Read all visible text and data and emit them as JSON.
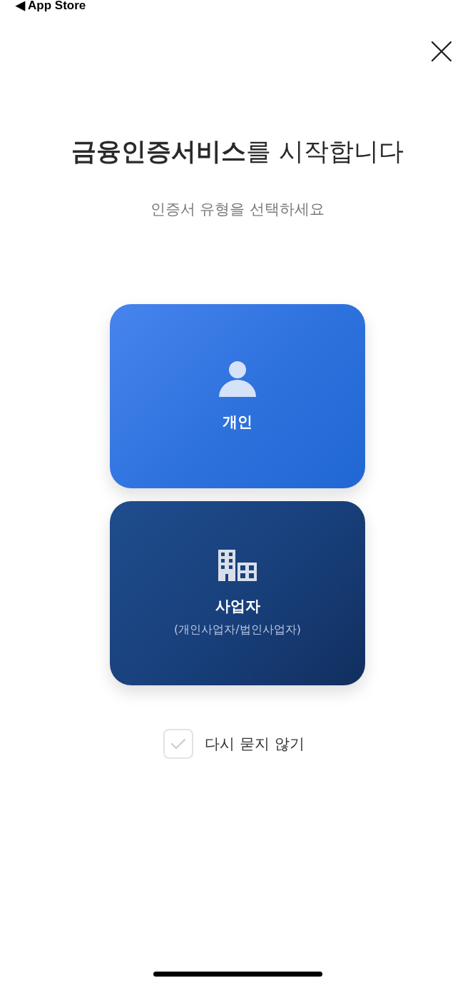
{
  "status_bar": {
    "back_link": "◀ App Store"
  },
  "title": "**금융인증서비스**를 시작합니다",
  "subtitle": "인증서 유형을 선택하세요",
  "certificate_types": [
    {
      "kind": "personal",
      "label": "개인"
    },
    {
      "kind": "business",
      "label": "사업자",
      "description": "(개인사업자/법인사업자)"
    }
  ],
  "dont_ask_again": {
    "label": "다시 묻지 않기",
    "checked": false
  }
}
